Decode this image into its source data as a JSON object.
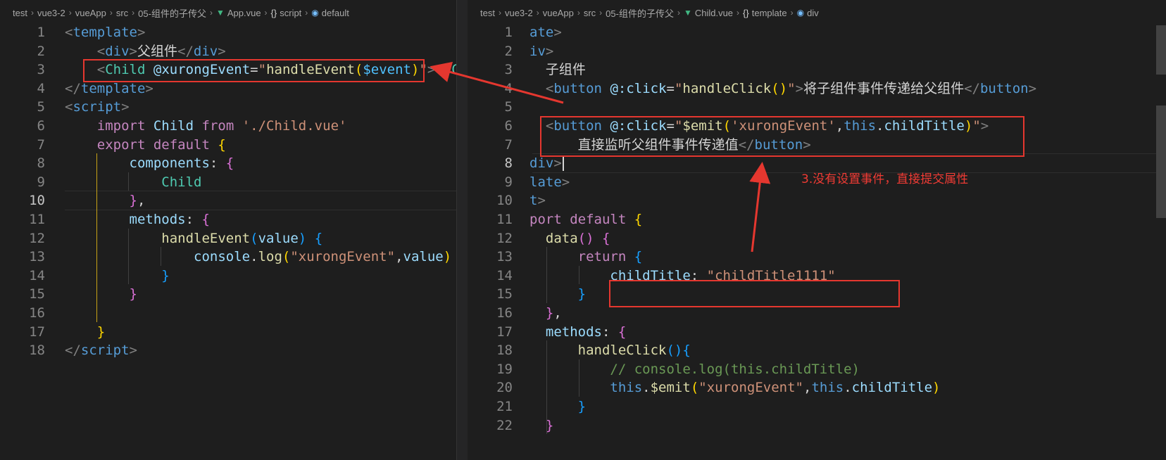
{
  "left": {
    "breadcrumb": [
      "test",
      "vue3-2",
      "vueApp",
      "src",
      "05-组件的子传父",
      "App.vue",
      "script",
      "default"
    ],
    "breadcrumb_icons": [
      "",
      "",
      "",
      "",
      "",
      "vue-icon",
      "braces-icon",
      "box-icon"
    ],
    "line_numbers": [
      "1",
      "2",
      "3",
      "4",
      "5",
      "6",
      "7",
      "8",
      "9",
      "10",
      "11",
      "12",
      "13",
      "14",
      "15",
      "16",
      "17",
      "18"
    ],
    "current_line": "10",
    "lines": [
      [
        [
          "t-br",
          "<"
        ],
        [
          "t-tag",
          "template"
        ],
        [
          "t-br",
          ">"
        ]
      ],
      [
        [
          "t-txt",
          "    "
        ],
        [
          "t-br",
          "<"
        ],
        [
          "t-tag",
          "div"
        ],
        [
          "t-br",
          ">"
        ],
        [
          "t-cn",
          "父组件"
        ],
        [
          "t-br",
          "</"
        ],
        [
          "t-tag",
          "div"
        ],
        [
          "t-br",
          ">"
        ]
      ],
      [
        [
          "t-txt",
          "    "
        ],
        [
          "t-br",
          "<"
        ],
        [
          "t-comp",
          "Child"
        ],
        [
          "t-txt",
          " "
        ],
        [
          "t-attr",
          "@xurongEvent"
        ],
        [
          "t-txt",
          "="
        ],
        [
          "t-str",
          "\""
        ],
        [
          "t-fn",
          "handleEvent"
        ],
        [
          "b1",
          "("
        ],
        [
          "t-var",
          "$event"
        ],
        [
          "b1",
          ")"
        ],
        [
          "t-str",
          "\""
        ],
        [
          "t-br",
          ">"
        ],
        [
          "t-br",
          "</"
        ],
        [
          "t-comp",
          "Ch"
        ]
      ],
      [
        [
          "t-br",
          "</"
        ],
        [
          "t-tag",
          "template"
        ],
        [
          "t-br",
          ">"
        ]
      ],
      [
        [
          "t-br",
          "<"
        ],
        [
          "t-tag",
          "script"
        ],
        [
          "t-br",
          ">"
        ]
      ],
      [
        [
          "t-txt",
          "    "
        ],
        [
          "t-kw",
          "import"
        ],
        [
          "t-txt",
          " "
        ],
        [
          "t-prop",
          "Child"
        ],
        [
          "t-txt",
          " "
        ],
        [
          "t-kw",
          "from"
        ],
        [
          "t-txt",
          " "
        ],
        [
          "t-str",
          "'./Child.vue'"
        ]
      ],
      [
        [
          "t-txt",
          "    "
        ],
        [
          "t-kw",
          "export"
        ],
        [
          "t-txt",
          " "
        ],
        [
          "t-kw",
          "default"
        ],
        [
          "t-txt",
          " "
        ],
        [
          "b1",
          "{"
        ]
      ],
      [
        [
          "t-txt",
          "        "
        ],
        [
          "t-prop",
          "components"
        ],
        [
          "t-txt",
          ": "
        ],
        [
          "b2",
          "{"
        ]
      ],
      [
        [
          "t-txt",
          "            "
        ],
        [
          "t-comp",
          "Child"
        ]
      ],
      [
        [
          "t-txt",
          "        "
        ],
        [
          "b2",
          "}"
        ],
        [
          "t-txt",
          ","
        ]
      ],
      [
        [
          "t-txt",
          "        "
        ],
        [
          "t-prop",
          "methods"
        ],
        [
          "t-txt",
          ": "
        ],
        [
          "b2",
          "{"
        ]
      ],
      [
        [
          "t-txt",
          "            "
        ],
        [
          "t-fn",
          "handleEvent"
        ],
        [
          "b3",
          "("
        ],
        [
          "t-prop",
          "value"
        ],
        [
          "b3",
          ")"
        ],
        [
          "t-txt",
          " "
        ],
        [
          "b3",
          "{"
        ]
      ],
      [
        [
          "t-txt",
          "                "
        ],
        [
          "t-prop",
          "console"
        ],
        [
          "t-txt",
          "."
        ],
        [
          "t-fn",
          "log"
        ],
        [
          "b1",
          "("
        ],
        [
          "t-str",
          "\"xurongEvent\""
        ],
        [
          "t-txt",
          ","
        ],
        [
          "t-prop",
          "value"
        ],
        [
          "b1",
          ")"
        ]
      ],
      [
        [
          "t-txt",
          "            "
        ],
        [
          "b3",
          "}"
        ]
      ],
      [
        [
          "t-txt",
          "        "
        ],
        [
          "b2",
          "}"
        ]
      ],
      [
        [
          "t-txt",
          ""
        ]
      ],
      [
        [
          "t-txt",
          "    "
        ],
        [
          "b1",
          "}"
        ]
      ],
      [
        [
          "t-br",
          "</"
        ],
        [
          "t-tag",
          "script"
        ],
        [
          "t-br",
          ">"
        ]
      ]
    ]
  },
  "right": {
    "breadcrumb": [
      "test",
      "vue3-2",
      "vueApp",
      "src",
      "05-组件的子传父",
      "Child.vue",
      "template",
      "div"
    ],
    "breadcrumb_icons": [
      "",
      "",
      "",
      "",
      "",
      "vue-icon",
      "braces-icon",
      "box-icon"
    ],
    "line_numbers": [
      "1",
      "2",
      "3",
      "4",
      "5",
      "6",
      "7",
      "8",
      "9",
      "10",
      "11",
      "12",
      "13",
      "14",
      "15",
      "16",
      "17",
      "18",
      "19",
      "20",
      "21",
      "22"
    ],
    "current_line": "8",
    "lines": [
      [
        [
          "t-tag",
          "ate"
        ],
        [
          "t-br",
          ">"
        ]
      ],
      [
        [
          "t-tag",
          "iv"
        ],
        [
          "t-br",
          ">"
        ]
      ],
      [
        [
          "t-txt",
          "  "
        ],
        [
          "t-cn",
          "子组件"
        ]
      ],
      [
        [
          "t-txt",
          "  "
        ],
        [
          "t-br",
          "<"
        ],
        [
          "t-tag",
          "button"
        ],
        [
          "t-txt",
          " "
        ],
        [
          "t-attr",
          "@:click"
        ],
        [
          "t-txt",
          "="
        ],
        [
          "t-str",
          "\""
        ],
        [
          "t-fn",
          "handleClick"
        ],
        [
          "b1",
          "()"
        ],
        [
          "t-str",
          "\""
        ],
        [
          "t-br",
          ">"
        ],
        [
          "t-cn",
          "将子组件事件传递给父组件"
        ],
        [
          "t-br",
          "</"
        ],
        [
          "t-tag",
          "button"
        ],
        [
          "t-br",
          ">"
        ]
      ],
      [
        [
          "t-txt",
          ""
        ]
      ],
      [
        [
          "t-txt",
          "  "
        ],
        [
          "t-br",
          "<"
        ],
        [
          "t-tag",
          "button"
        ],
        [
          "t-txt",
          " "
        ],
        [
          "t-attr",
          "@:click"
        ],
        [
          "t-txt",
          "="
        ],
        [
          "t-str",
          "\""
        ],
        [
          "t-fn",
          "$emit"
        ],
        [
          "b1",
          "("
        ],
        [
          "t-str",
          "'xurongEvent'"
        ],
        [
          "t-txt",
          ","
        ],
        [
          "t-blue",
          "this"
        ],
        [
          "t-txt",
          "."
        ],
        [
          "t-prop",
          "childTitle"
        ],
        [
          "b1",
          ")"
        ],
        [
          "t-str",
          "\""
        ],
        [
          "t-br",
          ">"
        ]
      ],
      [
        [
          "t-txt",
          "      "
        ],
        [
          "t-cn",
          "直接监听父组件事件传递值"
        ],
        [
          "t-br",
          "</"
        ],
        [
          "t-tag",
          "button"
        ],
        [
          "t-br",
          ">"
        ]
      ],
      [
        [
          "t-tag",
          "div"
        ],
        [
          "t-br",
          ">"
        ]
      ],
      [
        [
          "t-tag",
          "late"
        ],
        [
          "t-br",
          ">"
        ]
      ],
      [
        [
          "t-tag",
          "t"
        ],
        [
          "t-br",
          ">"
        ]
      ],
      [
        [
          "t-kw",
          "port"
        ],
        [
          "t-txt",
          " "
        ],
        [
          "t-kw",
          "default"
        ],
        [
          "t-txt",
          " "
        ],
        [
          "b1",
          "{"
        ]
      ],
      [
        [
          "t-txt",
          "  "
        ],
        [
          "t-fn",
          "data"
        ],
        [
          "b2",
          "()"
        ],
        [
          "t-txt",
          " "
        ],
        [
          "b2",
          "{"
        ]
      ],
      [
        [
          "t-txt",
          "      "
        ],
        [
          "t-kw",
          "return"
        ],
        [
          "t-txt",
          " "
        ],
        [
          "b3",
          "{"
        ]
      ],
      [
        [
          "t-txt",
          "          "
        ],
        [
          "t-prop",
          "childTitle"
        ],
        [
          "t-txt",
          ": "
        ],
        [
          "t-str",
          "\"childTitle1111\""
        ]
      ],
      [
        [
          "t-txt",
          "      "
        ],
        [
          "b3",
          "}"
        ]
      ],
      [
        [
          "t-txt",
          "  "
        ],
        [
          "b2",
          "}"
        ],
        [
          "t-txt",
          ","
        ]
      ],
      [
        [
          "t-txt",
          "  "
        ],
        [
          "t-prop",
          "methods"
        ],
        [
          "t-txt",
          ": "
        ],
        [
          "b2",
          "{"
        ]
      ],
      [
        [
          "t-txt",
          "      "
        ],
        [
          "t-fn",
          "handleClick"
        ],
        [
          "b3",
          "()"
        ],
        [
          "b3",
          "{"
        ]
      ],
      [
        [
          "t-txt",
          "          "
        ],
        [
          "t-com",
          "// console.log(this.childTitle)"
        ]
      ],
      [
        [
          "t-txt",
          "          "
        ],
        [
          "t-blue",
          "this"
        ],
        [
          "t-txt",
          "."
        ],
        [
          "t-fn",
          "$emit"
        ],
        [
          "b1",
          "("
        ],
        [
          "t-str",
          "\"xurongEvent\""
        ],
        [
          "t-txt",
          ","
        ],
        [
          "t-blue",
          "this"
        ],
        [
          "t-txt",
          "."
        ],
        [
          "t-prop",
          "childTitle"
        ],
        [
          "b1",
          ")"
        ]
      ],
      [
        [
          "t-txt",
          "      "
        ],
        [
          "b3",
          "}"
        ]
      ],
      [
        [
          "t-txt",
          "  "
        ],
        [
          "b2",
          "}"
        ]
      ]
    ]
  },
  "annotation_text": "3.没有设置事件，直接提交属性",
  "colors": {
    "annotation_red": "#e5372f",
    "background": "#1e1e1e"
  }
}
